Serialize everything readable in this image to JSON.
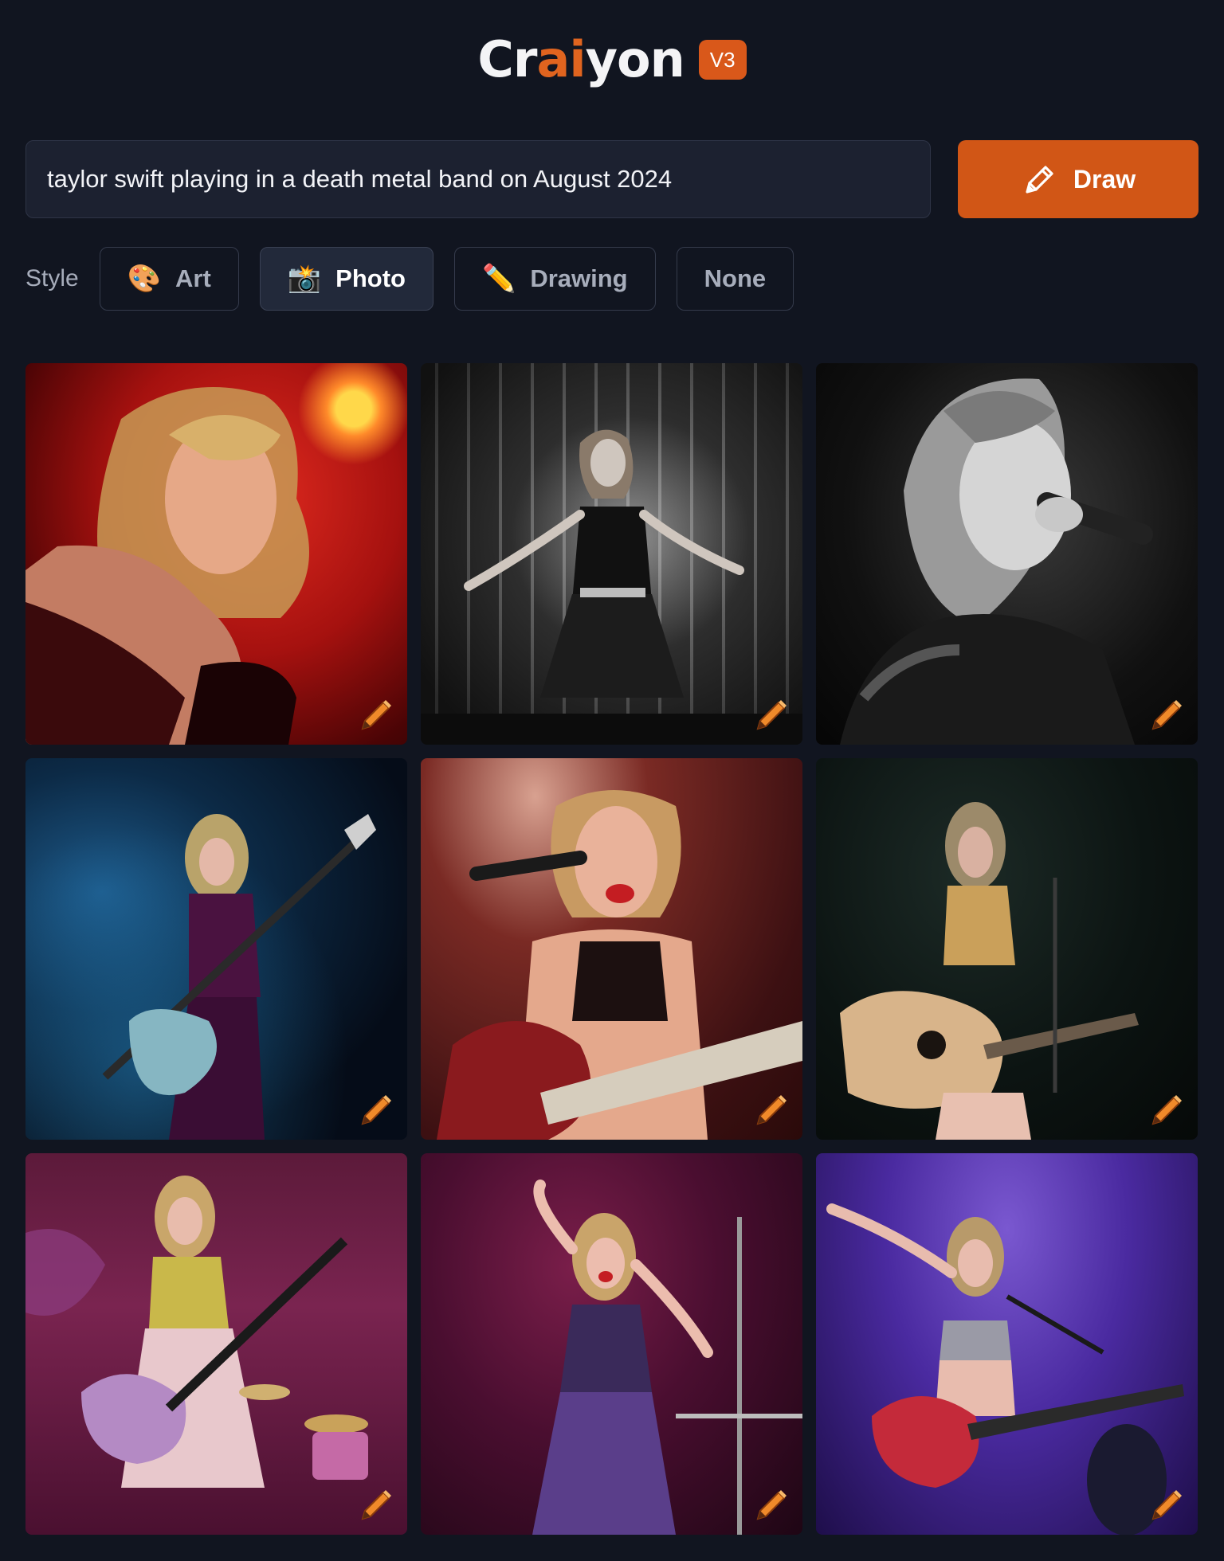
{
  "header": {
    "logo_prefix": "Cr",
    "logo_ai": "ai",
    "logo_suffix": "yon",
    "badge": "V3"
  },
  "prompt": {
    "value": "taylor swift playing in a death metal band on August 2024"
  },
  "draw_button": {
    "label": "Draw",
    "icon": "pencil-icon"
  },
  "style": {
    "label": "Style",
    "options": [
      {
        "label": "Art",
        "icon": "palette-icon",
        "emoji": "🎨",
        "active": false
      },
      {
        "label": "Photo",
        "icon": "camera-flash-icon",
        "emoji": "📸",
        "active": true
      },
      {
        "label": "Drawing",
        "icon": "pencil-icon",
        "emoji": "✏️",
        "active": false
      },
      {
        "label": "None",
        "active": false
      }
    ]
  },
  "colors": {
    "background": "#111520",
    "accent": "#d15616",
    "logo_ai": "#e0641f"
  },
  "results": [
    {
      "scene": "singer with guitar under red light",
      "edit_icon": "pencil-edit-icon"
    },
    {
      "scene": "black and white singer in dress at microphone",
      "edit_icon": "pencil-edit-icon"
    },
    {
      "scene": "black and white close-up singing into microphone",
      "edit_icon": "pencil-edit-icon"
    },
    {
      "scene": "guitarist in blue smoke",
      "edit_icon": "pencil-edit-icon"
    },
    {
      "scene": "singer with red guitar at microphone",
      "edit_icon": "pencil-edit-icon"
    },
    {
      "scene": "singer with acoustic guitar on dark stage",
      "edit_icon": "pencil-edit-icon"
    },
    {
      "scene": "guitarist with drum kit on pink stage",
      "edit_icon": "pencil-edit-icon"
    },
    {
      "scene": "singer in sequin dress on purple stage",
      "edit_icon": "pencil-edit-icon"
    },
    {
      "scene": "guitarist with arm raised on purple stage",
      "edit_icon": "pencil-edit-icon"
    }
  ]
}
